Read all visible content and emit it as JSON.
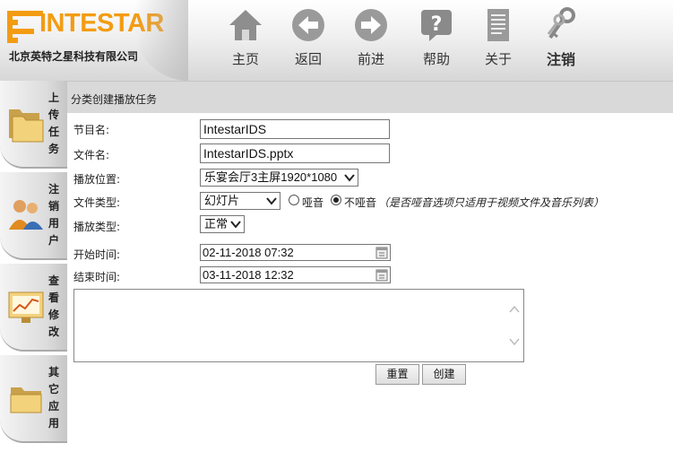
{
  "brand": {
    "name": "INTESTAR",
    "subtitle": "北京英特之星科技有限公司",
    "color": "#f39c12"
  },
  "nav": [
    {
      "label": "主页",
      "icon": "home-icon"
    },
    {
      "label": "返回",
      "icon": "back-icon"
    },
    {
      "label": "前进",
      "icon": "forward-icon"
    },
    {
      "label": "帮助",
      "icon": "help-icon"
    },
    {
      "label": "关于",
      "icon": "document-icon"
    },
    {
      "label": "注销",
      "icon": "keys-icon"
    }
  ],
  "sidebar": [
    {
      "label": "上传任务",
      "icon": "folders-icon"
    },
    {
      "label": "注销用户",
      "icon": "users-icon"
    },
    {
      "label": "查看修改",
      "icon": "chart-monitor-icon"
    },
    {
      "label": "其它应用",
      "icon": "folder-icon"
    }
  ],
  "page": {
    "title": "分类创建播放任务"
  },
  "form": {
    "program_name": {
      "label": "节目名:",
      "value": "IntestarIDS"
    },
    "file_name": {
      "label": "文件名:",
      "value": "IntestarIDS.pptx"
    },
    "location": {
      "label": "播放位置:",
      "value": "乐宴会厅3主屏1920*1080"
    },
    "file_type": {
      "label": "文件类型:",
      "value": "幻灯片",
      "mute_label": "哑音",
      "unmute_label": "不哑音",
      "selected": "不哑音",
      "note": "（是否哑音选项只适用于视频文件及音乐列表）"
    },
    "play_type": {
      "label": "播放类型:",
      "value": "正常"
    },
    "start_time": {
      "label": "开始时间:",
      "value": "02-11-2018 07:32"
    },
    "end_time": {
      "label": "结束时间:",
      "value": "03-11-2018 12:32"
    },
    "description": ""
  },
  "buttons": {
    "reset": "重置",
    "create": "创建"
  }
}
